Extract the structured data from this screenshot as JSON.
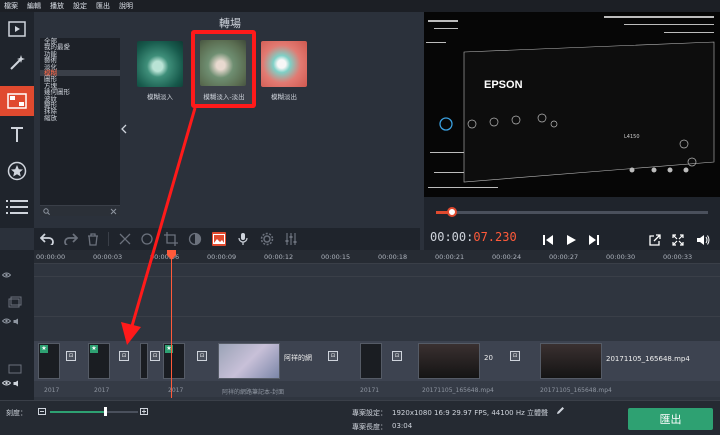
{
  "menu": [
    "檔案",
    "編輯",
    "播放",
    "設定",
    "匯出",
    "說明"
  ],
  "rail": {
    "items": [
      {
        "name": "media-import-icon"
      },
      {
        "name": "filters-wand-icon"
      },
      {
        "name": "transitions-icon",
        "active": true
      },
      {
        "name": "titles-icon"
      },
      {
        "name": "stickers-icon"
      },
      {
        "name": "more-list-icon"
      }
    ]
  },
  "transitions": {
    "title": "轉場",
    "categories": [
      "全部",
      "我的最愛",
      "功能",
      "藝術",
      "淡化",
      "模糊",
      "圖形",
      "方塊",
      "幾何圖形",
      "波紋",
      "變形",
      "抹除",
      "縮放"
    ],
    "selected_index": 5,
    "thumbs": [
      {
        "label": "模糊淡入",
        "color": "#2e7a66"
      },
      {
        "label": "模糊淡入-淡出",
        "color": "#7a8a6a",
        "highlighted": true
      },
      {
        "label": "模糊淡出",
        "color": "#e0706a"
      }
    ]
  },
  "preview": {
    "brand": "EPSON",
    "model": "L4150",
    "progress": 0.06
  },
  "transport": {
    "time_prefix": "00:00:",
    "time_red": "07.230"
  },
  "ruler": {
    "ticks": [
      "00:00:00",
      "00:00:03",
      "00:00:06",
      "00:00:09",
      "00:00:12",
      "00:00:15",
      "00:00:18",
      "00:00:21",
      "00:00:24",
      "00:00:27",
      "00:00:30",
      "00:00:33"
    ]
  },
  "timeline": {
    "clip_label_1": "阿祥的網",
    "clip_label_2": "20",
    "clip_label_3": "20171105_165648.mp4",
    "audio_labels": [
      "2017",
      "2017",
      "2017",
      "阿祥的網路筆記本-封面",
      "20171",
      "20171105_165648.mp4",
      "20171105_165648.mp4"
    ]
  },
  "bottom": {
    "zoom_label": "刻度：",
    "settings_label": "專案設定：",
    "settings_value": "1920x1080 16:9 29.97 FPS, 44100 Hz 立體聲",
    "length_label": "專案長度：",
    "length_value": "03:04",
    "export_label": "匯出",
    "zoom_value": 0.62
  },
  "colors": {
    "accent": "#e04a2f",
    "export": "#2ea172",
    "highlight_box": "#ff1a1a",
    "time_red": "#ff5a3a"
  }
}
